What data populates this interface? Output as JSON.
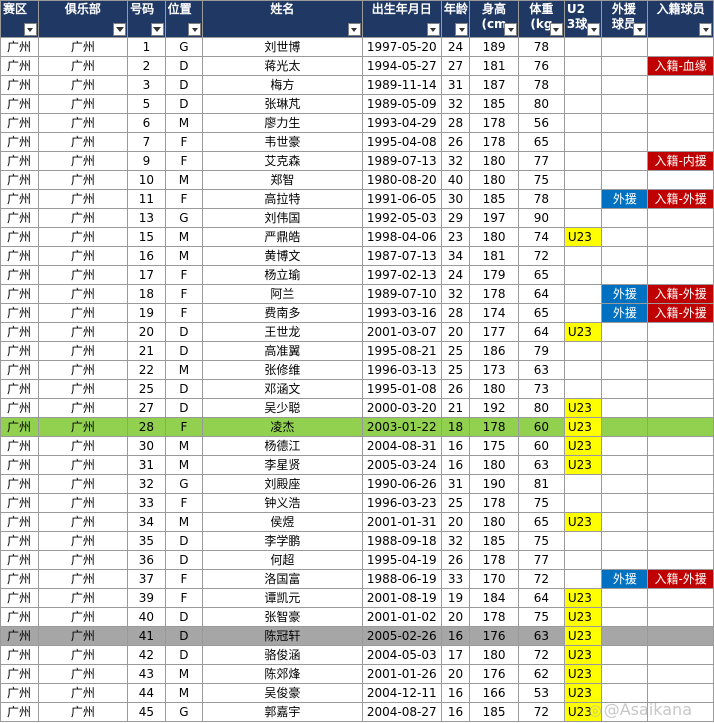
{
  "headers": [
    {
      "key": "region",
      "label": "赛区",
      "filter": "dropdown"
    },
    {
      "key": "club",
      "label": "俱乐部",
      "filter": "funnel"
    },
    {
      "key": "number",
      "label": "号码",
      "filter": "funnel"
    },
    {
      "key": "position",
      "label": "位置",
      "filter": "dropdown"
    },
    {
      "key": "name",
      "label": "姓名",
      "filter": "dropdown"
    },
    {
      "key": "dob",
      "label": "出生年月日",
      "filter": "dropdown"
    },
    {
      "key": "age",
      "label": "年龄",
      "filter": "dropdown"
    },
    {
      "key": "height",
      "label": "身高(cm",
      "filter": "dropdown"
    },
    {
      "key": "weight",
      "label": "体重(kg",
      "filter": "dropdown"
    },
    {
      "key": "u23",
      "label": "U23球",
      "filter": "dropdown"
    },
    {
      "key": "foreign",
      "label": "外援球员",
      "filter": "dropdown"
    },
    {
      "key": "naturalized",
      "label": "入籍球员",
      "filter": "dropdown"
    }
  ],
  "rows": [
    {
      "region": "广州",
      "club": "广州",
      "number": "1",
      "position": "G",
      "name": "刘世博",
      "dob": "1997-05-20",
      "age": "24",
      "height": "189",
      "weight": "78",
      "u23": "",
      "foreign": "",
      "naturalized": ""
    },
    {
      "region": "广州",
      "club": "广州",
      "number": "2",
      "position": "D",
      "name": "蒋光太",
      "dob": "1994-05-27",
      "age": "27",
      "height": "181",
      "weight": "76",
      "u23": "",
      "foreign": "",
      "naturalized": "入籍-血缘"
    },
    {
      "region": "广州",
      "club": "广州",
      "number": "3",
      "position": "D",
      "name": "梅方",
      "dob": "1989-11-14",
      "age": "31",
      "height": "187",
      "weight": "78",
      "u23": "",
      "foreign": "",
      "naturalized": ""
    },
    {
      "region": "广州",
      "club": "广州",
      "number": "5",
      "position": "D",
      "name": "张琳芃",
      "dob": "1989-05-09",
      "age": "32",
      "height": "185",
      "weight": "80",
      "u23": "",
      "foreign": "",
      "naturalized": ""
    },
    {
      "region": "广州",
      "club": "广州",
      "number": "6",
      "position": "M",
      "name": "廖力生",
      "dob": "1993-04-29",
      "age": "28",
      "height": "178",
      "weight": "56",
      "u23": "",
      "foreign": "",
      "naturalized": ""
    },
    {
      "region": "广州",
      "club": "广州",
      "number": "7",
      "position": "F",
      "name": "韦世豪",
      "dob": "1995-04-08",
      "age": "26",
      "height": "178",
      "weight": "65",
      "u23": "",
      "foreign": "",
      "naturalized": ""
    },
    {
      "region": "广州",
      "club": "广州",
      "number": "9",
      "position": "F",
      "name": "艾克森",
      "dob": "1989-07-13",
      "age": "32",
      "height": "180",
      "weight": "77",
      "u23": "",
      "foreign": "",
      "naturalized": "入籍-内援"
    },
    {
      "region": "广州",
      "club": "广州",
      "number": "10",
      "position": "M",
      "name": "郑智",
      "dob": "1980-08-20",
      "age": "40",
      "height": "180",
      "weight": "75",
      "u23": "",
      "foreign": "",
      "naturalized": ""
    },
    {
      "region": "广州",
      "club": "广州",
      "number": "11",
      "position": "F",
      "name": "高拉特",
      "dob": "1991-06-05",
      "age": "30",
      "height": "185",
      "weight": "78",
      "u23": "",
      "foreign": "外援",
      "naturalized": "入籍-外援"
    },
    {
      "region": "广州",
      "club": "广州",
      "number": "13",
      "position": "G",
      "name": "刘伟国",
      "dob": "1992-05-03",
      "age": "29",
      "height": "197",
      "weight": "90",
      "u23": "",
      "foreign": "",
      "naturalized": ""
    },
    {
      "region": "广州",
      "club": "广州",
      "number": "15",
      "position": "M",
      "name": "严鼎皓",
      "dob": "1998-04-06",
      "age": "23",
      "height": "180",
      "weight": "74",
      "u23": "U23",
      "foreign": "",
      "naturalized": ""
    },
    {
      "region": "广州",
      "club": "广州",
      "number": "16",
      "position": "M",
      "name": "黄博文",
      "dob": "1987-07-13",
      "age": "34",
      "height": "181",
      "weight": "72",
      "u23": "",
      "foreign": "",
      "naturalized": ""
    },
    {
      "region": "广州",
      "club": "广州",
      "number": "17",
      "position": "F",
      "name": "杨立瑜",
      "dob": "1997-02-13",
      "age": "24",
      "height": "179",
      "weight": "65",
      "u23": "",
      "foreign": "",
      "naturalized": ""
    },
    {
      "region": "广州",
      "club": "广州",
      "number": "18",
      "position": "F",
      "name": "阿兰",
      "dob": "1989-07-10",
      "age": "32",
      "height": "178",
      "weight": "64",
      "u23": "",
      "foreign": "外援",
      "naturalized": "入籍-外援"
    },
    {
      "region": "广州",
      "club": "广州",
      "number": "19",
      "position": "F",
      "name": "费南多",
      "dob": "1993-03-16",
      "age": "28",
      "height": "174",
      "weight": "65",
      "u23": "",
      "foreign": "外援",
      "naturalized": "入籍-外援"
    },
    {
      "region": "广州",
      "club": "广州",
      "number": "20",
      "position": "D",
      "name": "王世龙",
      "dob": "2001-03-07",
      "age": "20",
      "height": "177",
      "weight": "64",
      "u23": "U23",
      "foreign": "",
      "naturalized": ""
    },
    {
      "region": "广州",
      "club": "广州",
      "number": "21",
      "position": "D",
      "name": "高准翼",
      "dob": "1995-08-21",
      "age": "25",
      "height": "186",
      "weight": "79",
      "u23": "",
      "foreign": "",
      "naturalized": ""
    },
    {
      "region": "广州",
      "club": "广州",
      "number": "22",
      "position": "M",
      "name": "张修维",
      "dob": "1996-03-13",
      "age": "25",
      "height": "173",
      "weight": "63",
      "u23": "",
      "foreign": "",
      "naturalized": ""
    },
    {
      "region": "广州",
      "club": "广州",
      "number": "25",
      "position": "D",
      "name": "邓涵文",
      "dob": "1995-01-08",
      "age": "26",
      "height": "180",
      "weight": "73",
      "u23": "",
      "foreign": "",
      "naturalized": ""
    },
    {
      "region": "广州",
      "club": "广州",
      "number": "27",
      "position": "D",
      "name": "吴少聪",
      "dob": "2000-03-20",
      "age": "21",
      "height": "192",
      "weight": "80",
      "u23": "U23",
      "foreign": "",
      "naturalized": ""
    },
    {
      "region": "广州",
      "club": "广州",
      "number": "28",
      "position": "F",
      "name": "凌杰",
      "dob": "2003-01-22",
      "age": "18",
      "height": "178",
      "weight": "60",
      "u23": "U23",
      "foreign": "",
      "naturalized": "",
      "highlight": "green"
    },
    {
      "region": "广州",
      "club": "广州",
      "number": "30",
      "position": "M",
      "name": "杨德江",
      "dob": "2004-08-31",
      "age": "16",
      "height": "175",
      "weight": "60",
      "u23": "U23",
      "foreign": "",
      "naturalized": ""
    },
    {
      "region": "广州",
      "club": "广州",
      "number": "31",
      "position": "M",
      "name": "李星贤",
      "dob": "2005-03-24",
      "age": "16",
      "height": "180",
      "weight": "63",
      "u23": "U23",
      "foreign": "",
      "naturalized": ""
    },
    {
      "region": "广州",
      "club": "广州",
      "number": "32",
      "position": "G",
      "name": "刘殿座",
      "dob": "1990-06-26",
      "age": "31",
      "height": "190",
      "weight": "81",
      "u23": "",
      "foreign": "",
      "naturalized": ""
    },
    {
      "region": "广州",
      "club": "广州",
      "number": "33",
      "position": "F",
      "name": "钟义浩",
      "dob": "1996-03-23",
      "age": "25",
      "height": "178",
      "weight": "75",
      "u23": "",
      "foreign": "",
      "naturalized": ""
    },
    {
      "region": "广州",
      "club": "广州",
      "number": "34",
      "position": "M",
      "name": "侯煜",
      "dob": "2001-01-31",
      "age": "20",
      "height": "180",
      "weight": "65",
      "u23": "U23",
      "foreign": "",
      "naturalized": ""
    },
    {
      "region": "广州",
      "club": "广州",
      "number": "35",
      "position": "D",
      "name": "李学鹏",
      "dob": "1988-09-18",
      "age": "32",
      "height": "185",
      "weight": "75",
      "u23": "",
      "foreign": "",
      "naturalized": ""
    },
    {
      "region": "广州",
      "club": "广州",
      "number": "36",
      "position": "D",
      "name": "何超",
      "dob": "1995-04-19",
      "age": "26",
      "height": "178",
      "weight": "77",
      "u23": "",
      "foreign": "",
      "naturalized": ""
    },
    {
      "region": "广州",
      "club": "广州",
      "number": "37",
      "position": "F",
      "name": "洛国富",
      "dob": "1988-06-19",
      "age": "33",
      "height": "170",
      "weight": "72",
      "u23": "",
      "foreign": "外援",
      "naturalized": "入籍-外援"
    },
    {
      "region": "广州",
      "club": "广州",
      "number": "39",
      "position": "F",
      "name": "谭凯元",
      "dob": "2001-08-19",
      "age": "19",
      "height": "184",
      "weight": "64",
      "u23": "U23",
      "foreign": "",
      "naturalized": ""
    },
    {
      "region": "广州",
      "club": "广州",
      "number": "40",
      "position": "D",
      "name": "张智豪",
      "dob": "2001-01-02",
      "age": "20",
      "height": "178",
      "weight": "75",
      "u23": "U23",
      "foreign": "",
      "naturalized": ""
    },
    {
      "region": "广州",
      "club": "广州",
      "number": "41",
      "position": "D",
      "name": "陈冠轩",
      "dob": "2005-02-26",
      "age": "16",
      "height": "176",
      "weight": "63",
      "u23": "U23",
      "foreign": "",
      "naturalized": "",
      "highlight": "gray"
    },
    {
      "region": "广州",
      "club": "广州",
      "number": "42",
      "position": "D",
      "name": "骆俊涵",
      "dob": "2004-05-03",
      "age": "17",
      "height": "180",
      "weight": "72",
      "u23": "U23",
      "foreign": "",
      "naturalized": ""
    },
    {
      "region": "广州",
      "club": "广州",
      "number": "43",
      "position": "M",
      "name": "陈郊烽",
      "dob": "2001-01-26",
      "age": "20",
      "height": "176",
      "weight": "62",
      "u23": "U23",
      "foreign": "",
      "naturalized": ""
    },
    {
      "region": "广州",
      "club": "广州",
      "number": "44",
      "position": "M",
      "name": "吴俊豪",
      "dob": "2004-12-11",
      "age": "16",
      "height": "166",
      "weight": "53",
      "u23": "U23",
      "foreign": "",
      "naturalized": ""
    },
    {
      "region": "广州",
      "club": "广州",
      "number": "45",
      "position": "G",
      "name": "郭嘉宇",
      "dob": "2004-08-27",
      "age": "16",
      "height": "185",
      "weight": "72",
      "u23": "U23",
      "foreign": "",
      "naturalized": ""
    }
  ],
  "colors": {
    "header_bg": "#1f3864",
    "u23": "#ffff00",
    "foreign": "#0070c0",
    "naturalized": "#c00000",
    "row_green": "#92d050",
    "row_gray": "#a6a6a6"
  },
  "icons": {
    "dropdown": "chevron-down-icon",
    "funnel": "filter-icon"
  },
  "watermark": {
    "text": "@Asaikana"
  }
}
